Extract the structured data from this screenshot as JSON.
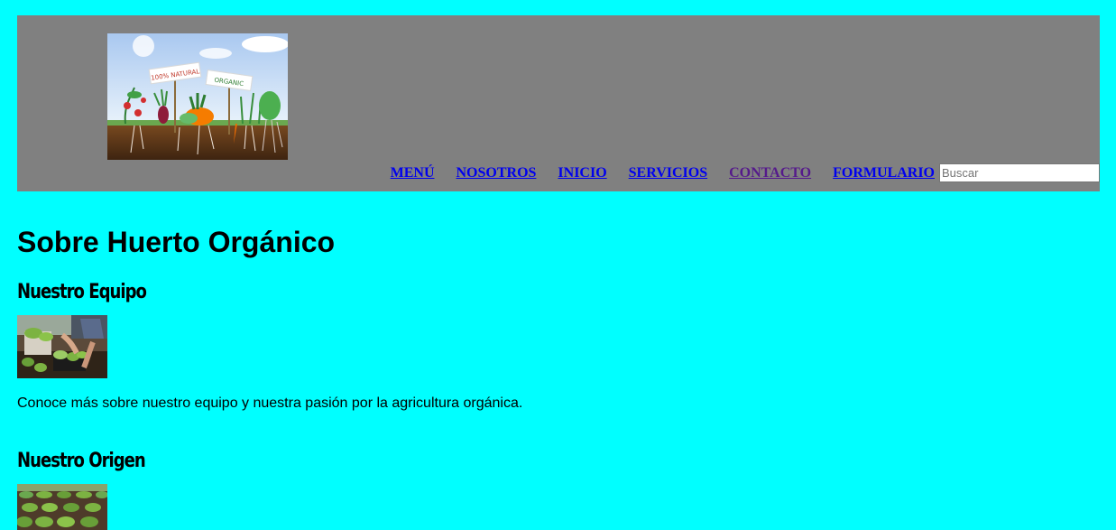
{
  "header": {
    "logo": {
      "sign1": "100% NATURAL",
      "sign2": "ORGANIC"
    },
    "nav": [
      {
        "label": "MENÚ"
      },
      {
        "label": "NOSOTROS"
      },
      {
        "label": "INICIO"
      },
      {
        "label": "SERVICIOS"
      },
      {
        "label": "CONTACTO"
      },
      {
        "label": "FORMULARIO"
      }
    ],
    "search": {
      "placeholder": "Buscar"
    }
  },
  "main": {
    "title": "Sobre Huerto Orgánico",
    "sections": [
      {
        "heading": "Nuestro Equipo",
        "text": "Conoce más sobre nuestro equipo y nuestra pasión por la agricultura orgánica."
      },
      {
        "heading": "Nuestro Origen"
      }
    ]
  },
  "colors": {
    "page_bg": "#00ffff",
    "header_bg": "#808080",
    "link": "#0000ee",
    "visited_link": "#551a8b"
  }
}
